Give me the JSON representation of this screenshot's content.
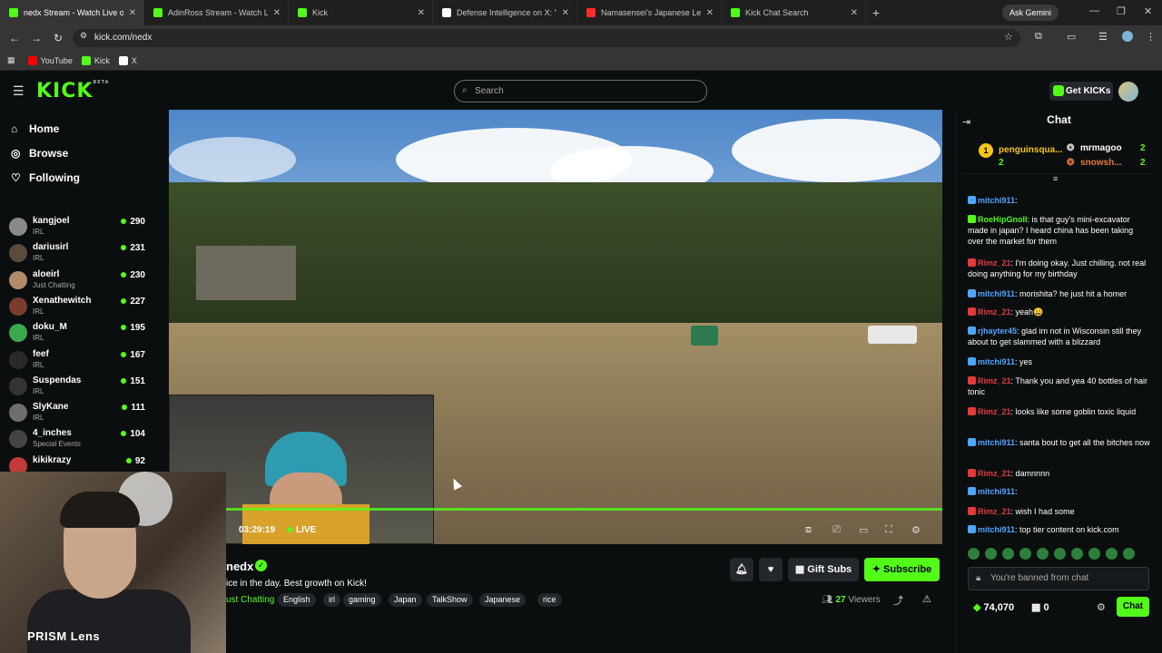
{
  "browser": {
    "tabs": [
      {
        "title": "nedx Stream - Watch Live o",
        "color": "#53fc18",
        "active": true
      },
      {
        "title": "AdinRoss Stream - Watch Live o",
        "color": "#53fc18",
        "active": false
      },
      {
        "title": "Kick",
        "color": "#53fc18",
        "active": false
      },
      {
        "title": "Defense Intelligence on X: \"Bus",
        "color": "#ffffff",
        "active": false
      },
      {
        "title": "Namasensei's Japanese Lesson",
        "color": "#ff2b2b",
        "active": false
      },
      {
        "title": "Kick Chat Search",
        "color": "#53fc18",
        "active": false
      }
    ],
    "gemini_label": "Ask Gemini",
    "url": "kick.com/nedx",
    "bookmarks": [
      {
        "label": "YouTube",
        "color": "#ff0000"
      },
      {
        "label": "Kick",
        "color": "#53fc18"
      },
      {
        "label": "X",
        "color": "#ffffff"
      }
    ]
  },
  "header": {
    "logo": "KICK",
    "logo_beta": "BETA",
    "search_placeholder": "Search",
    "get_kicks": "Get KICKs"
  },
  "sidebar": {
    "nav": [
      {
        "label": "Home",
        "icon": "home-icon",
        "glyph": "⌂"
      },
      {
        "label": "Browse",
        "icon": "compass-icon",
        "glyph": "◎"
      },
      {
        "label": "Following",
        "icon": "heart-icon",
        "glyph": "♡"
      }
    ],
    "channels": [
      {
        "name": "kangjoel",
        "category": "IRL",
        "viewers": "290",
        "color": "#8a8a8a"
      },
      {
        "name": "dariusirl",
        "category": "IRL",
        "viewers": "231",
        "color": "#5a4b3c"
      },
      {
        "name": "aloeirl",
        "category": "Just Chatting",
        "viewers": "230",
        "color": "#b08b6a"
      },
      {
        "name": "Xenathewitch",
        "category": "IRL",
        "viewers": "227",
        "color": "#7a3c2c"
      },
      {
        "name": "doku_M",
        "category": "IRL",
        "viewers": "195",
        "color": "#3aa84e"
      },
      {
        "name": "feef",
        "category": "IRL",
        "viewers": "167",
        "color": "#2a2a2a"
      },
      {
        "name": "Suspendas",
        "category": "IRL",
        "viewers": "151",
        "color": "#333333"
      },
      {
        "name": "SlyKane",
        "category": "IRL",
        "viewers": "111",
        "color": "#6e6e6e"
      },
      {
        "name": "4_inches",
        "category": "Special Events",
        "viewers": "104",
        "color": "#444444"
      },
      {
        "name": "kikikrazy",
        "category": "",
        "viewers": "92",
        "color": "#c23a3a"
      }
    ]
  },
  "stream": {
    "time": "03:29:19",
    "live": "LIVE",
    "channel": "nedx",
    "title": "ice in the day. Best growth on Kick!",
    "category": "ust Chatting",
    "tags": [
      "English",
      "irl",
      "gaming",
      "Japan",
      "TalkShow",
      "Japanese",
      "rice"
    ],
    "viewers_count": "27",
    "viewers_label": "Viewers",
    "gift_subs": "Gift Subs",
    "subscribe": "Subscribe",
    "overlay_label": "PRISM Lens"
  },
  "chat": {
    "title": "Chat",
    "gifters": [
      {
        "name": "penguinsqua...",
        "count": "2",
        "rank": "1"
      },
      {
        "name": "mrmagoo",
        "count": "2"
      },
      {
        "name": "snowsh...",
        "count": "2"
      }
    ],
    "messages": [
      {
        "user": "mitchi911",
        "color": "#4ea6ff",
        "text": ""
      },
      {
        "user": "RoeHipGnoll",
        "color": "#53fc18",
        "text": "is that guy's mini-excavator made in japan? I heard china has been taking over the market for them"
      },
      {
        "user": "Rimz_21",
        "color": "#e23a3a",
        "text": "I'm doing okay. Just chilling. not real doing anything for my birthday"
      },
      {
        "user": "mitchi911",
        "color": "#4ea6ff",
        "text": "morishita? he just hit a homer"
      },
      {
        "user": "Rimz_21",
        "color": "#e23a3a",
        "text": "yeah😄"
      },
      {
        "user": "rjhayter45",
        "color": "#4ea6ff",
        "text": "glad im not in Wisconsin still they about to get slammed with a blizzard"
      },
      {
        "user": "mitchi911",
        "color": "#4ea6ff",
        "text": "yes"
      },
      {
        "user": "Rimz_21",
        "color": "#e23a3a",
        "text": "Thank you and yea 40 bottles of hair tonic"
      },
      {
        "user": "Rimz_21",
        "color": "#e23a3a",
        "text": "looks like some goblin toxic liquid"
      },
      {
        "user": "mitchi911",
        "color": "#4ea6ff",
        "text": "santa bout to get all the bitches now"
      },
      {
        "user": "Rimz_21",
        "color": "#e23a3a",
        "text": "damnnnn"
      },
      {
        "user": "mitchi911",
        "color": "#4ea6ff",
        "text": ""
      },
      {
        "user": "Rimz_21",
        "color": "#e23a3a",
        "text": "wish I had some"
      },
      {
        "user": "mitchi911",
        "color": "#4ea6ff",
        "text": "top tier content on kick.com"
      }
    ],
    "banned_text": "You're banned from chat",
    "kicks_balance": "74,070",
    "sub_count": "0",
    "send_label": "Chat"
  }
}
